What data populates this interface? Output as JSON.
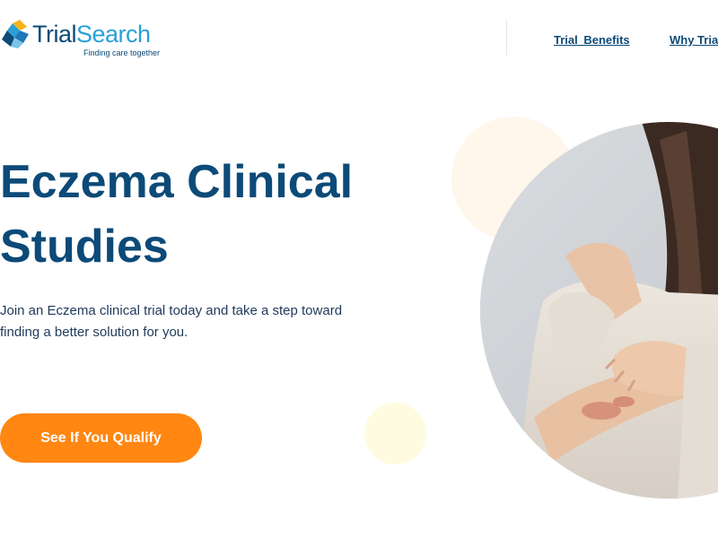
{
  "brand": {
    "name_part1": "Trial",
    "name_part2": "Search",
    "tagline": "Finding care together",
    "logo_icon": "logo-mark-icon"
  },
  "nav": {
    "items": [
      {
        "label": "Trial  Benefits"
      },
      {
        "label": "Why Trial"
      }
    ]
  },
  "hero": {
    "title": "Eczema Clinical Studies",
    "subtitle": "Join an Eczema clinical trial today and take a step toward finding a better solution for you.",
    "cta_label": "See If You Qualify",
    "image": "woman-scratching-arm-photo"
  },
  "colors": {
    "primary": "#0c4a78",
    "accent_blue": "#2aa0d8",
    "cta_orange": "#ff8712",
    "deco_peach": "#fff6ec",
    "deco_yellow": "#fffbe0"
  }
}
